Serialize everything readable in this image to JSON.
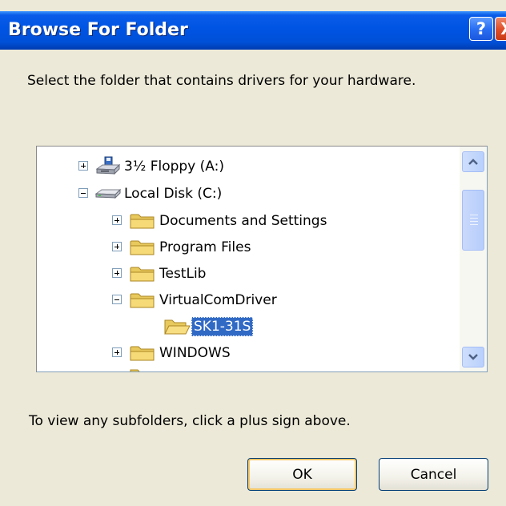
{
  "window": {
    "title": "Browse For Folder",
    "help_label": "?",
    "close_label": "X"
  },
  "instruction": "Select the folder that contains drivers for your hardware.",
  "tree": {
    "items": [
      {
        "label": "3½ Floppy (A:)",
        "expander": "plus",
        "icon": "floppy-drive-icon"
      },
      {
        "label": "Local Disk (C:)",
        "expander": "minus",
        "icon": "hard-disk-icon"
      },
      {
        "label": "Documents and Settings",
        "expander": "plus",
        "icon": "folder-icon"
      },
      {
        "label": "Program Files",
        "expander": "plus",
        "icon": "folder-icon"
      },
      {
        "label": "TestLib",
        "expander": "plus",
        "icon": "folder-icon"
      },
      {
        "label": "VirtualComDriver",
        "expander": "minus",
        "icon": "folder-icon"
      },
      {
        "label": "SK1-31S",
        "expander": "none",
        "icon": "open-folder-icon",
        "selected": true
      },
      {
        "label": "WINDOWS",
        "expander": "plus",
        "icon": "folder-icon"
      }
    ]
  },
  "hint": "To view any subfolders, click a plus sign above.",
  "buttons": {
    "ok_label": "OK",
    "cancel_label": "Cancel"
  },
  "colors": {
    "titlebar": "#0054e3",
    "selection": "#316ac5",
    "dialog_bg": "#ece9d8"
  }
}
